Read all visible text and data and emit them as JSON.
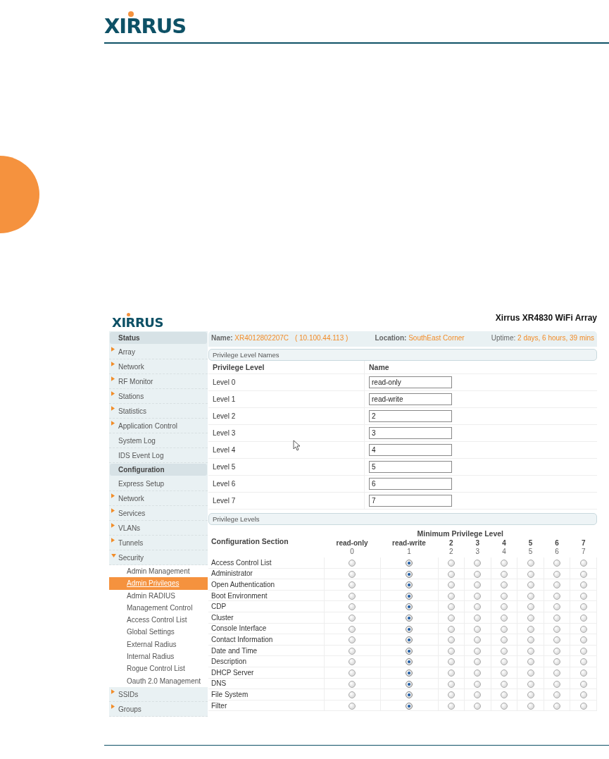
{
  "page_header": {
    "logo": "XIRRUS"
  },
  "screenshot": {
    "logo": "XIRRUS",
    "title": "Xirrus XR4830 WiFi Array",
    "info_bar": {
      "name_label": "Name:",
      "name_value": "XR4012802207C",
      "ip": "( 10.100.44.113 )",
      "location_label": "Location:",
      "location_value": "SouthEast Corner",
      "uptime_label": "Uptime:",
      "uptime_value": "2 days, 6 hours, 39 mins"
    },
    "sidebar": [
      {
        "label": "Status",
        "kind": "header"
      },
      {
        "label": "Array",
        "kind": "group"
      },
      {
        "label": "Network",
        "kind": "group"
      },
      {
        "label": "RF Monitor",
        "kind": "group"
      },
      {
        "label": "Stations",
        "kind": "group"
      },
      {
        "label": "Statistics",
        "kind": "group"
      },
      {
        "label": "Application Control",
        "kind": "group"
      },
      {
        "label": "System Log",
        "kind": "link"
      },
      {
        "label": "IDS Event Log",
        "kind": "link"
      },
      {
        "label": "Configuration",
        "kind": "header"
      },
      {
        "label": "Express Setup",
        "kind": "link"
      },
      {
        "label": "Network",
        "kind": "group"
      },
      {
        "label": "Services",
        "kind": "group"
      },
      {
        "label": "VLANs",
        "kind": "group"
      },
      {
        "label": "Tunnels",
        "kind": "group"
      },
      {
        "label": "Security",
        "kind": "open_group",
        "children": [
          {
            "label": "Admin Management",
            "selected": false
          },
          {
            "label": "Admin Privileges",
            "selected": true
          },
          {
            "label": "Admin RADIUS",
            "selected": false
          },
          {
            "label": "Management Control",
            "selected": false
          },
          {
            "label": "Access Control List",
            "selected": false
          },
          {
            "label": "Global Settings",
            "selected": false
          },
          {
            "label": "External Radius",
            "selected": false
          },
          {
            "label": "Internal Radius",
            "selected": false
          },
          {
            "label": "Rogue Control List",
            "selected": false
          },
          {
            "label": "Oauth 2.0 Management",
            "selected": false
          }
        ]
      },
      {
        "label": "SSIDs",
        "kind": "group"
      },
      {
        "label": "Groups",
        "kind": "group"
      }
    ],
    "names_section": {
      "title": "Privilege Level Names",
      "col_level": "Privilege Level",
      "col_name": "Name",
      "rows": [
        {
          "level": "Level 0",
          "value": "read-only"
        },
        {
          "level": "Level 1",
          "value": "read-write"
        },
        {
          "level": "Level 2",
          "value": "2"
        },
        {
          "level": "Level 3",
          "value": "3"
        },
        {
          "level": "Level 4",
          "value": "4"
        },
        {
          "level": "Level 5",
          "value": "5"
        },
        {
          "level": "Level 6",
          "value": "6"
        },
        {
          "level": "Level 7",
          "value": "7"
        }
      ]
    },
    "levels_section": {
      "title": "Privilege Levels",
      "group_heading": "Minimum Privilege Level",
      "col_section": "Configuration Section",
      "columns": [
        {
          "name": "read-only",
          "number": "0"
        },
        {
          "name": "read-write",
          "number": "1"
        },
        {
          "name": "2",
          "number": "2"
        },
        {
          "name": "3",
          "number": "3"
        },
        {
          "name": "4",
          "number": "4"
        },
        {
          "name": "5",
          "number": "5"
        },
        {
          "name": "6",
          "number": "6"
        },
        {
          "name": "7",
          "number": "7"
        }
      ],
      "rows": [
        {
          "section": "Access Control List",
          "selected": [
            false,
            true,
            false,
            false,
            false,
            false,
            false,
            false
          ]
        },
        {
          "section": "Administrator",
          "selected": [
            false,
            true,
            false,
            false,
            false,
            false,
            false,
            false
          ]
        },
        {
          "section": "Open Authentication",
          "selected": [
            false,
            true,
            false,
            false,
            false,
            false,
            false,
            false
          ]
        },
        {
          "section": "Boot Environment",
          "selected": [
            false,
            true,
            false,
            false,
            false,
            false,
            false,
            false
          ]
        },
        {
          "section": "CDP",
          "selected": [
            false,
            true,
            false,
            false,
            false,
            false,
            false,
            false
          ]
        },
        {
          "section": "Cluster",
          "selected": [
            false,
            true,
            false,
            false,
            false,
            false,
            false,
            false
          ]
        },
        {
          "section": "Console Interface",
          "selected": [
            false,
            true,
            false,
            false,
            false,
            false,
            false,
            false
          ]
        },
        {
          "section": "Contact Information",
          "selected": [
            false,
            true,
            false,
            false,
            false,
            false,
            false,
            false
          ]
        },
        {
          "section": "Date and Time",
          "selected": [
            false,
            true,
            false,
            false,
            false,
            false,
            false,
            false
          ]
        },
        {
          "section": "Description",
          "selected": [
            false,
            true,
            false,
            false,
            false,
            false,
            false,
            false
          ]
        },
        {
          "section": "DHCP Server",
          "selected": [
            false,
            true,
            false,
            false,
            false,
            false,
            false,
            false
          ]
        },
        {
          "section": "DNS",
          "selected": [
            false,
            true,
            false,
            false,
            false,
            false,
            false,
            false
          ]
        },
        {
          "section": "File System",
          "selected": [
            false,
            true,
            false,
            false,
            false,
            false,
            false,
            false
          ]
        },
        {
          "section": "Filter",
          "selected": [
            false,
            true,
            false,
            false,
            false,
            false,
            false,
            false
          ]
        }
      ]
    }
  }
}
